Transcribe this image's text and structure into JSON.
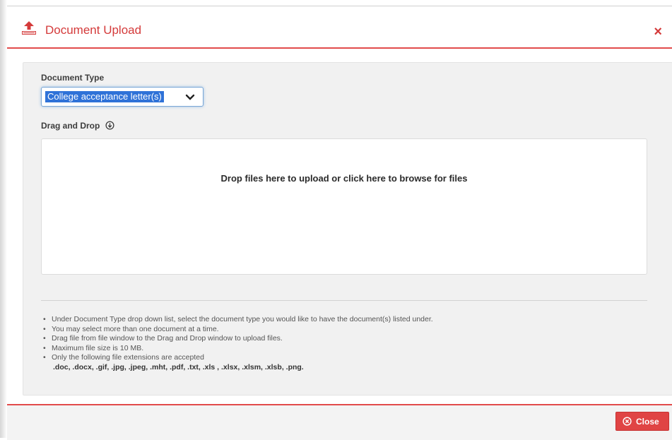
{
  "dialog": {
    "title": "Document Upload",
    "close_x": "×",
    "accent_color": "#d43a3a"
  },
  "document_type": {
    "label": "Document Type",
    "selected": "College acceptance letter(s)"
  },
  "drag_drop": {
    "label": "Drag and Drop",
    "drop_text": "Drop files here to upload or click here to browse for files"
  },
  "notes": {
    "items": [
      "Under Document Type drop down list, select the document type you would like to have the document(s) listed under.",
      "You may select more than one document at a time.",
      "Drag file from file window to the Drag and Drop window to upload files.",
      "Maximum file size is 10 MB.",
      "Only the following file extensions are accepted"
    ],
    "extensions": ".doc, .docx, .gif, .jpg, .jpeg, .mht, .pdf, .txt, .xls , .xlsx, .xlsm, .xlsb, .png."
  },
  "footer": {
    "close_label": "Close"
  },
  "icons": {
    "header": "upload-icon",
    "select": "chevron-down-icon",
    "drag_drop": "circle-arrow-down-icon",
    "close_button": "circle-x-icon"
  }
}
